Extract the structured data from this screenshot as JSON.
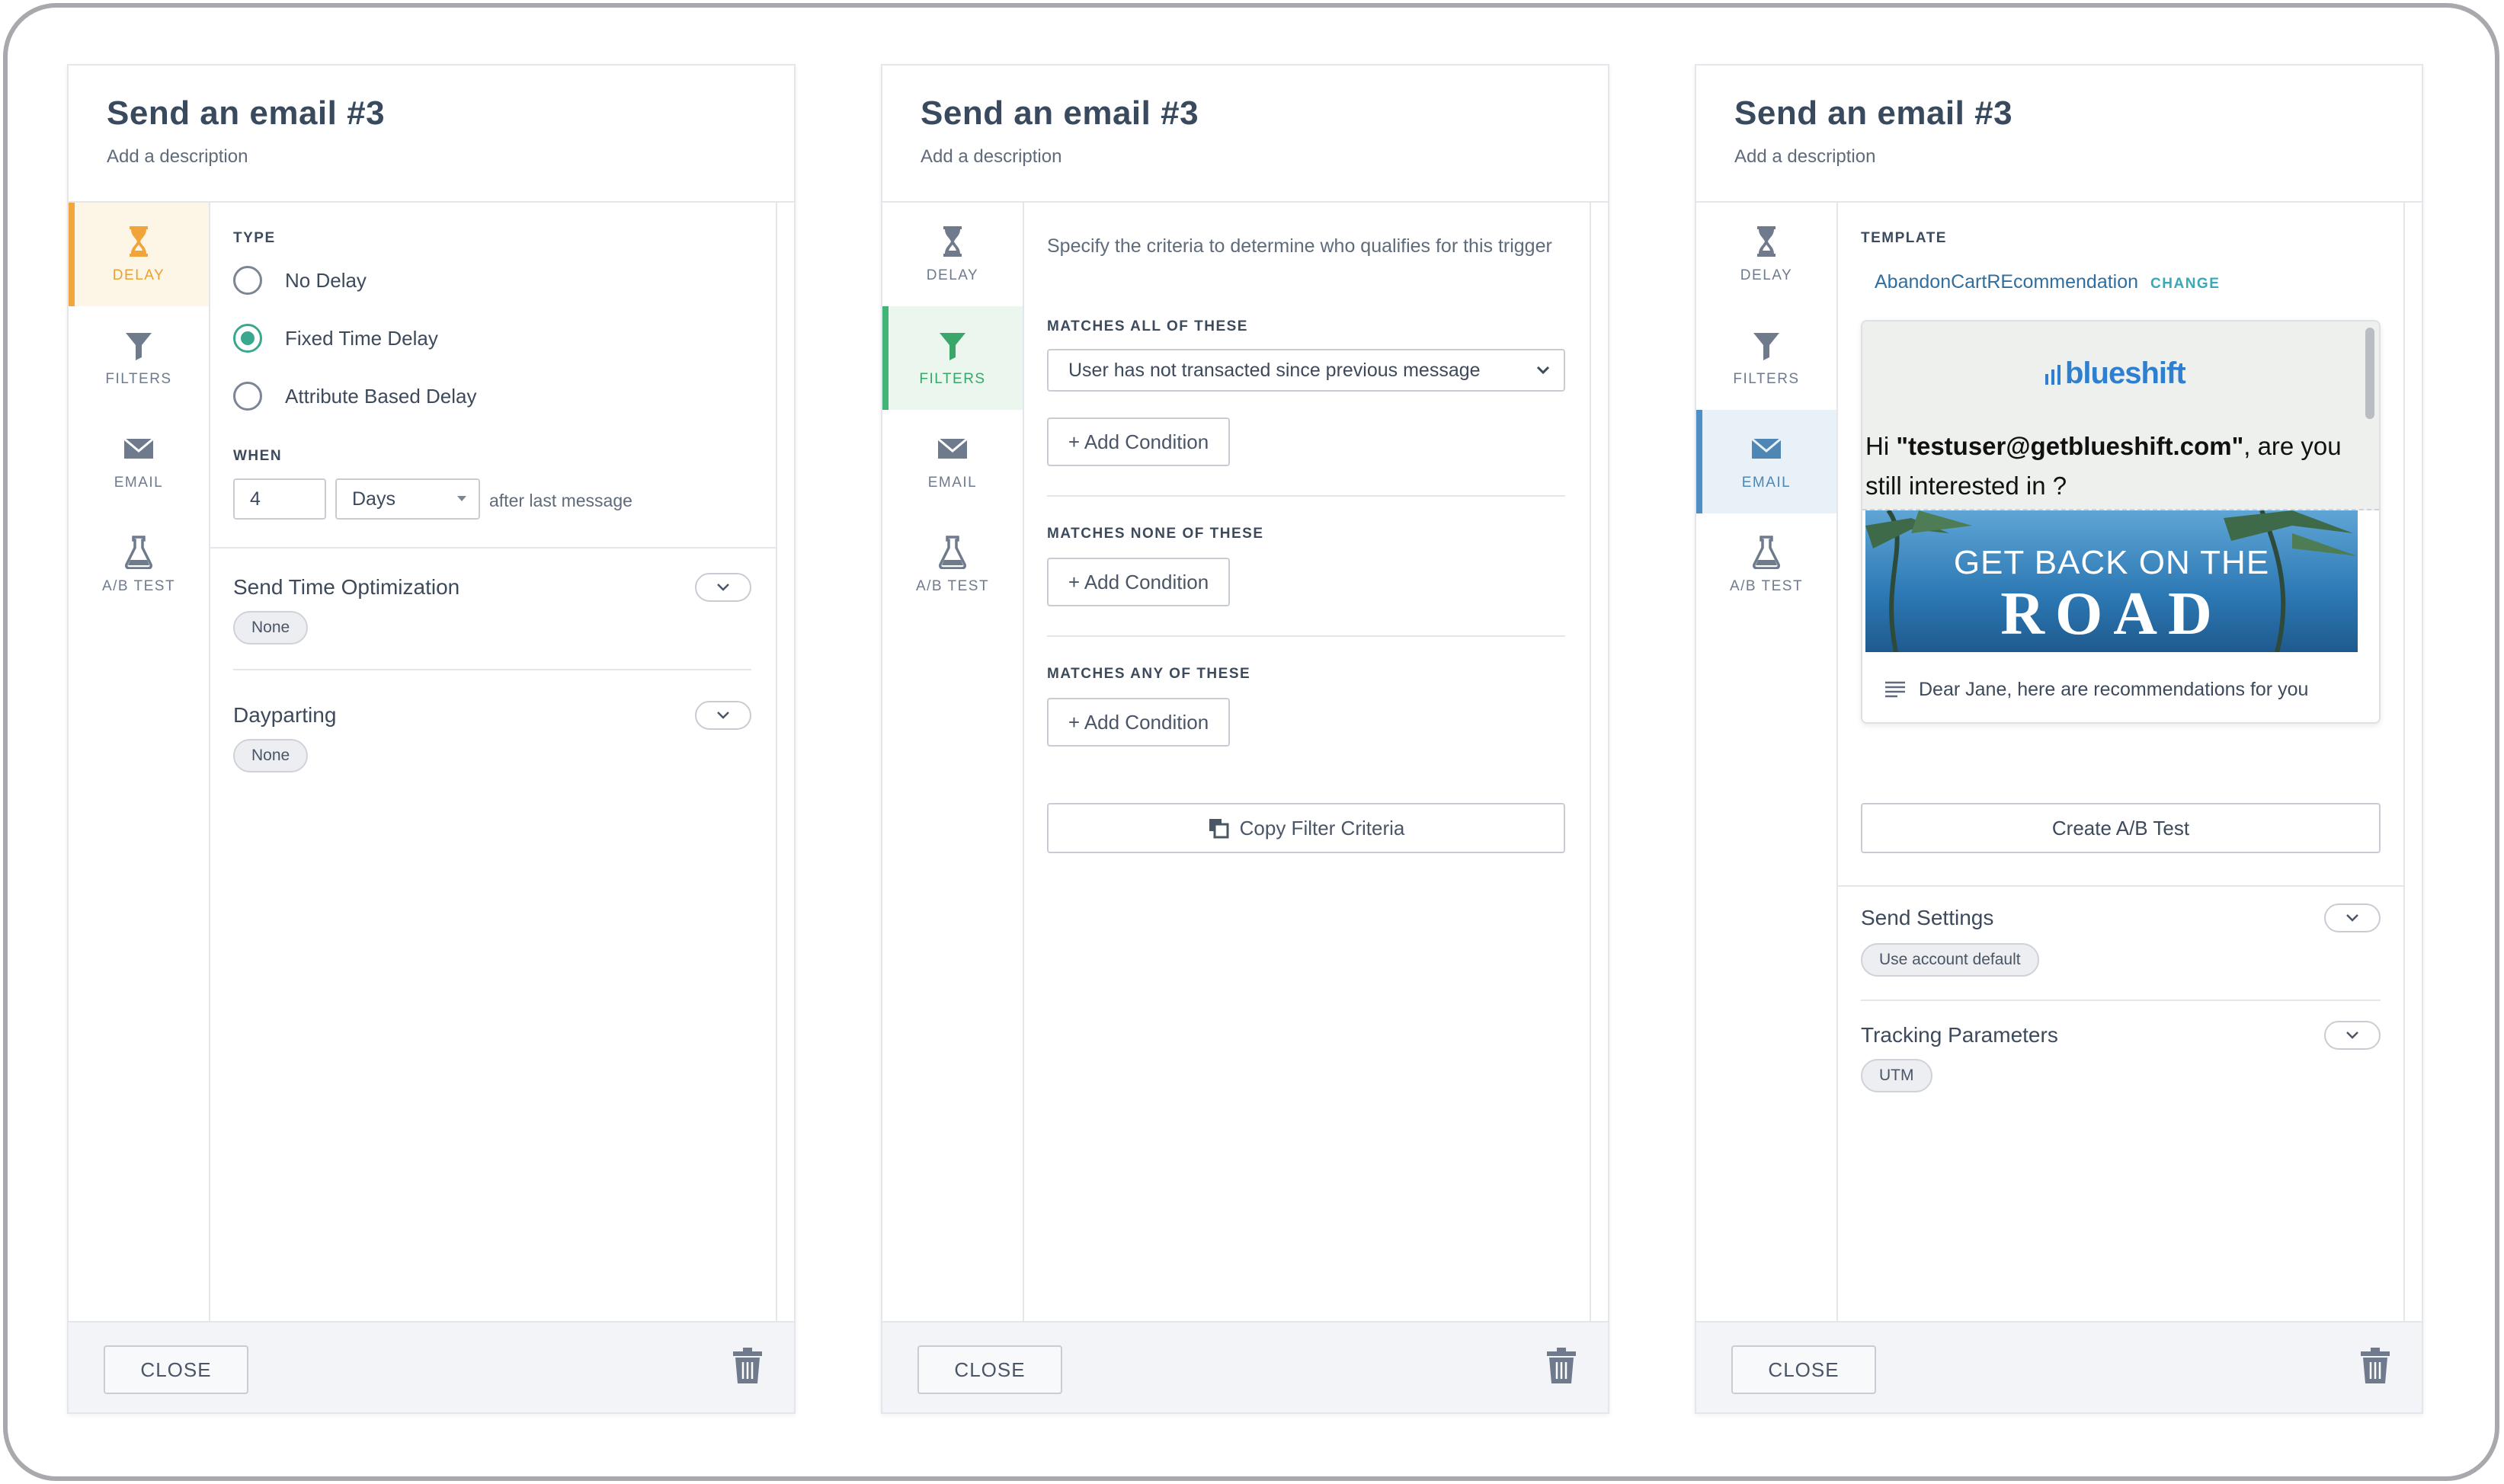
{
  "panels": [
    {
      "title": "Send an email #3",
      "description": "Add a description",
      "close_label": "CLOSE"
    },
    {
      "title": "Send an email #3",
      "description": "Add a description",
      "close_label": "CLOSE"
    },
    {
      "title": "Send an email #3",
      "description": "Add a description",
      "close_label": "CLOSE"
    }
  ],
  "sidebar": {
    "delay": "DELAY",
    "filters": "FILTERS",
    "email": "EMAIL",
    "abtest": "A/B TEST"
  },
  "delay": {
    "type_label": "TYPE",
    "options": [
      "No Delay",
      "Fixed Time Delay",
      "Attribute Based Delay"
    ],
    "selected": "Fixed Time Delay",
    "when_label": "WHEN",
    "when_value": "4",
    "unit": "Days",
    "after_text": "after last message",
    "sto_title": "Send Time Optimization",
    "sto_value": "None",
    "dayparting_title": "Dayparting",
    "dayparting_value": "None"
  },
  "filters": {
    "intro": "Specify the criteria to determine who qualifies for this trigger",
    "all_label": "MATCHES ALL OF THESE",
    "all_condition": "User has not transacted since previous message",
    "none_label": "MATCHES NONE OF THESE",
    "any_label": "MATCHES ANY OF THESE",
    "add_condition": "+ Add Condition",
    "copy_label": "Copy Filter Criteria"
  },
  "email": {
    "template_label": "TEMPLATE",
    "template_name": "AbandonCartREcommendation",
    "change_label": "CHANGE",
    "preview_logo": "blueshift",
    "preview_greeting_pre": "Hi ",
    "preview_greeting_user": "\"testuser@getblueshift.com\"",
    "preview_greeting_post": ", are you still interested in ?",
    "banner_line1": "GET BACK ON THE",
    "banner_line2": "ROAD",
    "preview_subject": "Dear Jane, here are recommendations for you",
    "create_ab": "Create A/B Test",
    "send_settings_title": "Send Settings",
    "send_settings_value": "Use account default",
    "tracking_title": "Tracking Parameters",
    "tracking_value": "UTM"
  },
  "colors": {
    "delay_accent": "#f2a63c",
    "filters_accent": "#41b477",
    "email_accent": "#4f8fc6",
    "radio_selected": "#3aa88e",
    "link": "#2f6e9e",
    "change": "#3aa8b5"
  }
}
